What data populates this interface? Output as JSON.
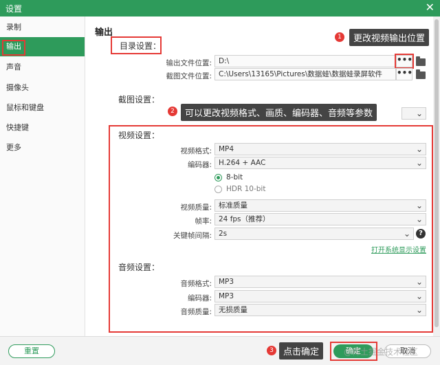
{
  "window": {
    "title": "设置",
    "close_glyph": "✕"
  },
  "sidebar": {
    "items": [
      {
        "label": "录制"
      },
      {
        "label": "输出"
      },
      {
        "label": "声音"
      },
      {
        "label": "摄像头"
      },
      {
        "label": "鼠标和键盘"
      },
      {
        "label": "快捷键"
      },
      {
        "label": "更多"
      }
    ],
    "active_index": 1
  },
  "main": {
    "heading": "输出",
    "directory": {
      "title": "目录设置：",
      "output_label": "输出文件位置:",
      "output_value": "D:\\",
      "screenshot_label": "截图文件位置:",
      "screenshot_value": "C:\\Users\\13165\\Pictures\\数据蛙\\数据蛙录屏软件",
      "dots": "•••"
    },
    "screenshot_settings": {
      "title": "截图设置："
    },
    "video": {
      "title": "视频设置：",
      "format_label": "视频格式:",
      "format_value": "MP4",
      "encoder_label": "编码器:",
      "encoder_value": "H.264 + AAC",
      "bit_options": [
        "8-bit",
        "HDR 10-bit"
      ],
      "quality_label": "视频质量:",
      "quality_value": "标准质量",
      "fps_label": "帧率:",
      "fps_value": "24 fps（推荐）",
      "keyframe_label": "关键帧间隔:",
      "keyframe_value": "2s",
      "help_glyph": "?",
      "link_text": "打开系统显示设置"
    },
    "audio": {
      "title": "音频设置：",
      "format_label": "音频格式:",
      "format_value": "MP3",
      "encoder_label": "编码器:",
      "encoder_value": "MP3",
      "quality_label": "音频质量:",
      "quality_value": "无损质量"
    }
  },
  "annotations": {
    "n1": "1",
    "c1": "更改视频输出位置",
    "n2": "2",
    "c2": "可以更改视频格式、画质、编码器、音频等参数",
    "n3": "3",
    "c3": "点击确定"
  },
  "footer": {
    "reset": "重置",
    "ok": "确定",
    "cancel": "取消",
    "watermark": "@稀土掘金技术社区"
  },
  "colors": {
    "accent": "#2e9b5b",
    "highlight": "#e53935"
  },
  "icons": {
    "folder": "folder-icon",
    "chevron": "chevron-down-icon",
    "help": "help-icon",
    "close": "close-icon"
  }
}
